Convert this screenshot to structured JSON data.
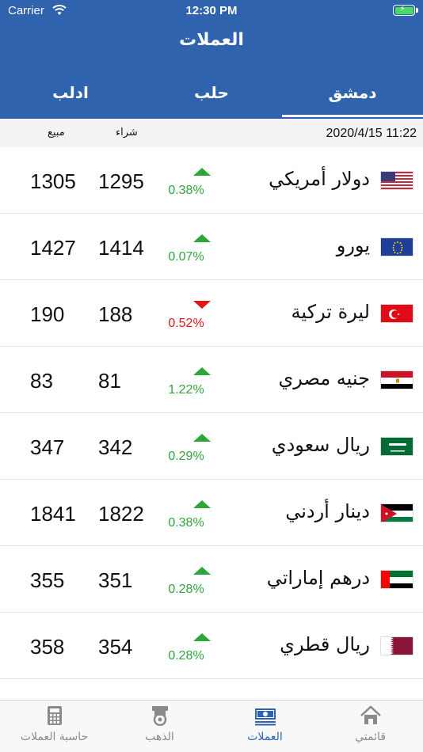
{
  "status": {
    "carrier": "Carrier",
    "time": "12:30 PM"
  },
  "header": {
    "title": "العملات"
  },
  "tabs": [
    {
      "label": "دمشق",
      "active": true
    },
    {
      "label": "حلب",
      "active": false
    },
    {
      "label": "ادلب",
      "active": false
    }
  ],
  "subheader": {
    "date": "2020/4/15 11:22",
    "buy_label": "شراء",
    "sell_label": "مبيع"
  },
  "rows": [
    {
      "name": "دولار أمريكي",
      "flag": "us-flag",
      "change": "0.38%",
      "direction": "up",
      "buy": "1295",
      "sell": "1305"
    },
    {
      "name": "يورو",
      "flag": "eu-flag",
      "change": "0.07%",
      "direction": "up",
      "buy": "1414",
      "sell": "1427"
    },
    {
      "name": "ليرة تركية",
      "flag": "tr-flag",
      "change": "0.52%",
      "direction": "down",
      "buy": "188",
      "sell": "190"
    },
    {
      "name": "جنيه مصري",
      "flag": "eg-flag",
      "change": "1.22%",
      "direction": "up",
      "buy": "81",
      "sell": "83"
    },
    {
      "name": "ريال سعودي",
      "flag": "sa-flag",
      "change": "0.29%",
      "direction": "up",
      "buy": "342",
      "sell": "347"
    },
    {
      "name": "دينار أردني",
      "flag": "jo-flag",
      "change": "0.38%",
      "direction": "up",
      "buy": "1822",
      "sell": "1841"
    },
    {
      "name": "درهم إماراتي",
      "flag": "ae-flag",
      "change": "0.28%",
      "direction": "up",
      "buy": "351",
      "sell": "355"
    },
    {
      "name": "ريال قطري",
      "flag": "qa-flag",
      "change": "0.28%",
      "direction": "up",
      "buy": "354",
      "sell": "358"
    }
  ],
  "tabbar": [
    {
      "label": "قائمتي",
      "icon": "home-icon",
      "active": false
    },
    {
      "label": "العملات",
      "icon": "banknote-icon",
      "active": true
    },
    {
      "label": "الذهب",
      "icon": "gold-icon",
      "active": false
    },
    {
      "label": "حاسبة العملات",
      "icon": "calculator-icon",
      "active": false
    }
  ],
  "colors": {
    "primary": "#2f63ae",
    "up": "#2fa53a",
    "down": "#e0161d"
  }
}
